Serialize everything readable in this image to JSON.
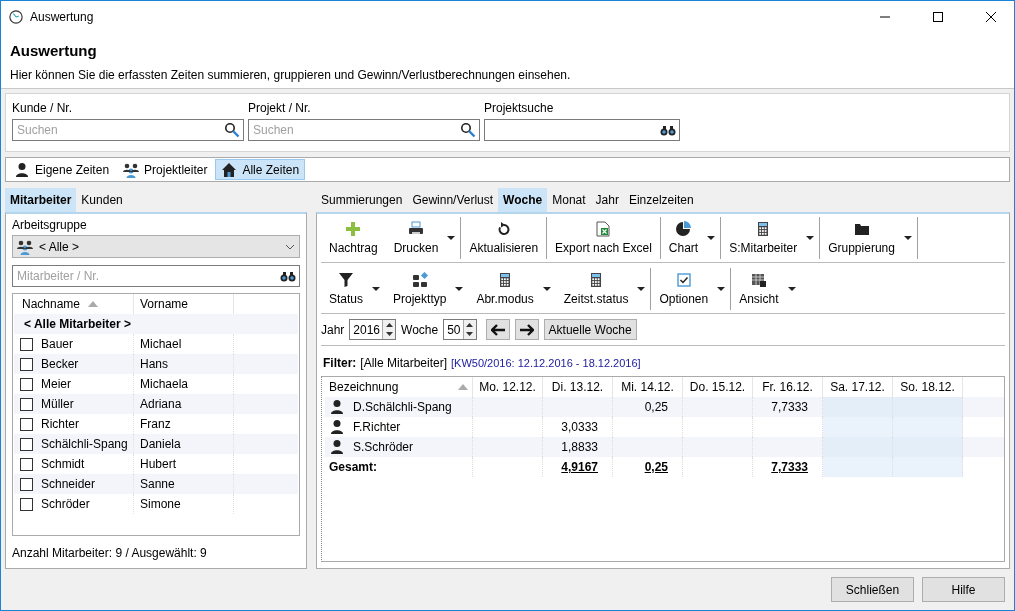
{
  "window": {
    "title": "Auswertung"
  },
  "header": {
    "title": "Auswertung",
    "description": "Hier können Sie die erfassten Zeiten summieren, gruppieren und Gewinn/Verlustberechnungen einsehen."
  },
  "search_fields": [
    {
      "label": "Kunde / Nr.",
      "placeholder": "Suchen",
      "kind": "search"
    },
    {
      "label": "Projekt / Nr.",
      "placeholder": "Suchen",
      "kind": "search"
    },
    {
      "label": "Projektsuche",
      "kind": "binoculars"
    }
  ],
  "scope_tabs": [
    {
      "label": "Eigene Zeiten",
      "kind": "person",
      "selected": false
    },
    {
      "label": "Projektleiter",
      "kind": "group",
      "selected": false
    },
    {
      "label": "Alle Zeiten",
      "kind": "home",
      "selected": true
    }
  ],
  "left_panel": {
    "tabs": [
      {
        "label": "Mitarbeiter",
        "selected": true
      },
      {
        "label": "Kunden",
        "selected": false
      }
    ],
    "workgroup_label": "Arbeitsgruppe",
    "workgroup_value": "< Alle >",
    "employee_search": {
      "placeholder": "Mitarbeiter / Nr."
    },
    "columns": [
      "Nachname",
      "Vorname"
    ],
    "all_row": "< Alle Mitarbeiter >",
    "rows": [
      {
        "last_name": "Bauer",
        "first_name": "Michael",
        "checked": false
      },
      {
        "last_name": "Becker",
        "first_name": "Hans",
        "checked": false
      },
      {
        "last_name": "Meier",
        "first_name": "Michaela",
        "checked": false
      },
      {
        "last_name": "Müller",
        "first_name": "Adriana",
        "checked": false
      },
      {
        "last_name": "Richter",
        "first_name": "Franz",
        "checked": false
      },
      {
        "last_name": "Schälchli-Spang",
        "first_name": "Daniela",
        "checked": false
      },
      {
        "last_name": "Schmidt",
        "first_name": "Hubert",
        "checked": false
      },
      {
        "last_name": "Schneider",
        "first_name": "Sanne",
        "checked": false
      },
      {
        "last_name": "Schröder",
        "first_name": "Simone",
        "checked": false
      }
    ],
    "footer": "Anzahl Mitarbeiter: 9 / Ausgewählt: 9"
  },
  "view_tabs": [
    {
      "label": "Summierungen",
      "selected": false
    },
    {
      "label": "Gewinn/Verlust",
      "selected": false
    },
    {
      "label": "Woche",
      "selected": true
    },
    {
      "label": "Monat",
      "selected": false
    },
    {
      "label": "Jahr",
      "selected": false
    },
    {
      "label": "Einzelzeiten",
      "selected": false
    }
  ],
  "toolbar_rows": [
    [
      {
        "label": "Nachtrag",
        "kind": "add",
        "dropdown": false,
        "separator": false
      },
      {
        "label": "Drucken",
        "kind": "print",
        "dropdown": true,
        "separator": true
      },
      {
        "label": "Aktualisieren",
        "kind": "refresh",
        "dropdown": false,
        "separator": true
      },
      {
        "label": "Export nach Excel",
        "kind": "excel",
        "dropdown": false,
        "separator": true
      },
      {
        "label": "Chart",
        "kind": "chart",
        "dropdown": true,
        "separator": true
      },
      {
        "label": "S:Mitarbeiter",
        "kind": "calc",
        "dropdown": true,
        "separator": true
      },
      {
        "label": "Gruppierung",
        "kind": "folder",
        "dropdown": true,
        "separator": true
      }
    ],
    [
      {
        "label": "Status",
        "kind": "filter",
        "dropdown": true,
        "separator": false
      },
      {
        "label": "Projekttyp",
        "kind": "tiles",
        "dropdown": true,
        "separator": false
      },
      {
        "label": "Abr.modus",
        "kind": "calc",
        "dropdown": true,
        "separator": false
      },
      {
        "label": "Zeitst.status",
        "kind": "calc",
        "dropdown": true,
        "separator": true
      },
      {
        "label": "Optionen",
        "kind": "check",
        "dropdown": true,
        "separator": true
      },
      {
        "label": "Ansicht",
        "kind": "table",
        "dropdown": true,
        "separator": false
      }
    ]
  ],
  "navigation": {
    "year_label": "Jahr",
    "year": "2016",
    "week_label": "Woche",
    "week": "50",
    "today_button": "Aktuelle Woche"
  },
  "filter": {
    "label": "Filter:",
    "value": "[Alle Mitarbeiter]",
    "range": "[KW50/2016: 12.12.2016 - 18.12.2016]"
  },
  "grid": {
    "columns": [
      {
        "label": "Bezeichnung"
      },
      {
        "label": "Mo. 12.12.",
        "weekend": false
      },
      {
        "label": "Di. 13.12.",
        "weekend": false
      },
      {
        "label": "Mi. 14.12.",
        "weekend": false
      },
      {
        "label": "Do. 15.12.",
        "weekend": false
      },
      {
        "label": "Fr. 16.12.",
        "weekend": false
      },
      {
        "label": "Sa. 17.12.",
        "weekend": true
      },
      {
        "label": "So. 18.12.",
        "weekend": true
      }
    ],
    "rows": [
      {
        "cells": [
          {
            "text": "D.Schälchli-Spang"
          },
          {},
          {},
          {
            "text": "0,25"
          },
          {},
          {
            "text": "7,7333"
          },
          {},
          {}
        ]
      },
      {
        "cells": [
          {
            "text": "F.Richter"
          },
          {},
          {
            "text": "3,0333"
          },
          {},
          {},
          {},
          {},
          {}
        ]
      },
      {
        "cells": [
          {
            "text": "S.Schröder"
          },
          {},
          {
            "text": "1,8833"
          },
          {},
          {},
          {},
          {},
          {}
        ]
      }
    ],
    "total": {
      "cells": [
        {
          "text": "Gesamt:"
        },
        {},
        {
          "text": "4,9167"
        },
        {
          "text": "0,25"
        },
        {},
        {
          "text": "7,7333"
        },
        {},
        {}
      ]
    }
  },
  "buttons": [
    "Schließen",
    "Hilfe"
  ]
}
